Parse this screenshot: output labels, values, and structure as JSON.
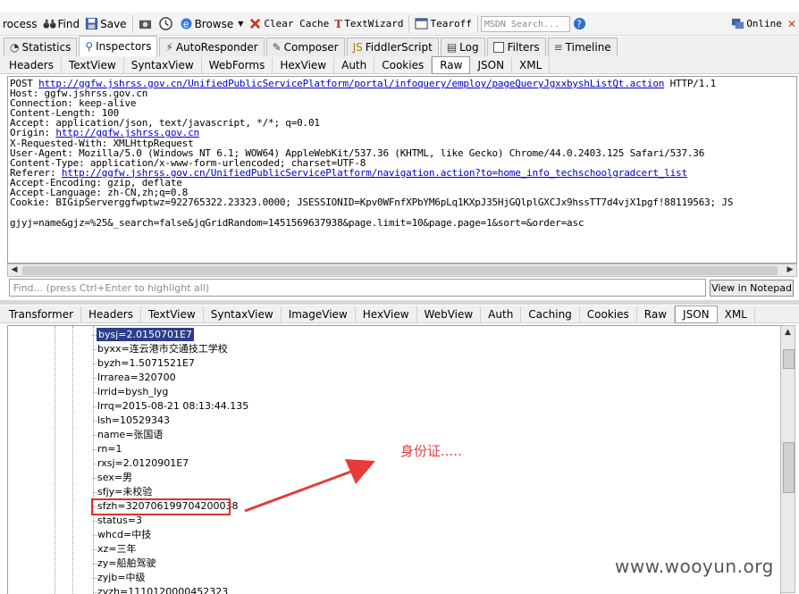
{
  "toolbar": {
    "process": "rocess",
    "find": "Find",
    "save": "Save",
    "browse": "Browse",
    "clear_cache": "Clear Cache",
    "textwizard": "TextWizard",
    "tearoff": "Tearoff",
    "msdn_placeholder": "MSDN Search...",
    "online": "Online"
  },
  "main_tabs": [
    "Statistics",
    "Inspectors",
    "AutoResponder",
    "Composer",
    "FiddlerScript",
    "Log",
    "Filters",
    "Timeline"
  ],
  "request_tabs": [
    "Headers",
    "TextView",
    "SyntaxView",
    "WebForms",
    "HexView",
    "Auth",
    "Cookies",
    "Raw",
    "JSON",
    "XML"
  ],
  "request": {
    "l1_pre": "POST ",
    "l1_url": "http://ggfw.jshrss.gov.cn/UnifiedPublicServicePlatform/portal/infoquery/employ/pageQueryJgxxbyshListQt.action",
    "l1_post": " HTTP/1.1",
    "l2": "Host: ggfw.jshrss.gov.cn",
    "l3": "Connection: keep-alive",
    "l4": "Content-Length: 100",
    "l5": "Accept: application/json, text/javascript, */*; q=0.01",
    "l6_pre": "Origin: ",
    "l6_url": "http://ggfw.jshrss.gov.cn",
    "l7": "X-Requested-With: XMLHttpRequest",
    "l8": "User-Agent: Mozilla/5.0 (Windows NT 6.1; WOW64) AppleWebKit/537.36 (KHTML, like Gecko) Chrome/44.0.2403.125 Safari/537.36",
    "l9": "Content-Type: application/x-www-form-urlencoded; charset=UTF-8",
    "l10_pre": "Referer: ",
    "l10_url": "http://ggfw.jshrss.gov.cn/UnifiedPublicServicePlatform/navigation.action?to=home_info_techschoolgradcert_list",
    "l11": "Accept-Encoding: gzip, deflate",
    "l12": "Accept-Language: zh-CN,zh;q=0.8",
    "l13": "Cookie: BIGipServerggfwptwz=922765322.23323.0000; JSESSIONID=Kpv0WFnfXPbYM6pLq1KXpJ35HjGQlplGXCJx9hssTT7d4vjX1pgf!88119563; JS",
    "body": "gjyj=name&gjz=%25&_search=false&jqGridRandom=1451569637938&page.limit=10&page.page=1&sort=&order=asc"
  },
  "find_placeholder": "Find... (press Ctrl+Enter to highlight all)",
  "view_in_notepad": "View in Notepad",
  "response_tabs": [
    "Transformer",
    "Headers",
    "TextView",
    "SyntaxView",
    "ImageView",
    "HexView",
    "WebView",
    "Auth",
    "Caching",
    "Cookies",
    "Raw",
    "JSON",
    "XML"
  ],
  "tree_nodes": [
    "bysj=2.0150701E7",
    "byxx=连云港市交通技工学校",
    "byzh=1.5071521E7",
    "lrrarea=320700",
    "lrrid=bysh_lyg",
    "lrrq=2015-08-21 08:13:44.135",
    "lsh=10529343",
    "name=张国语",
    "rn=1",
    "rxsj=2.0120901E7",
    "sex=男",
    "sfjy=未校验",
    "sfzh=320706199704200038",
    "status=3",
    "whcd=中技",
    "xz=三年",
    "zy=船舶驾驶",
    "zyjb=中级",
    "zyzh=1110120000452323"
  ],
  "annotation": "身份证.....",
  "watermark": "www.wooyun.org",
  "colors": {
    "highlight_box": "#e03030",
    "annotation": "#e04040",
    "selection": "#2a3f8a",
    "link": "#0000cc"
  }
}
